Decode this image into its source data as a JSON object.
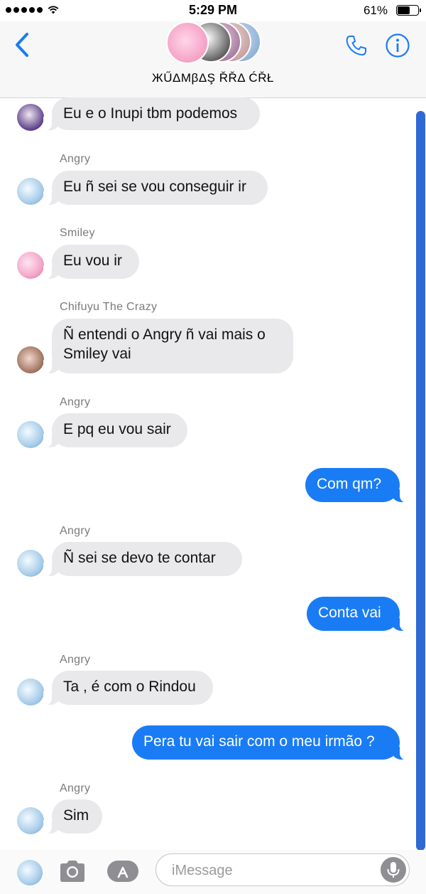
{
  "status_bar": {
    "time": "5:29 PM",
    "battery_percent": "61%",
    "battery_level": 0.61
  },
  "header": {
    "title": "ЖŰΔMβΔŞ ŘŘΔ ĆŘŁ",
    "back_icon": "chevron-left-icon",
    "call_icon": "phone-icon",
    "info_icon": "info-icon"
  },
  "messages": [
    {
      "sender": "",
      "text": "Eu e o Inupi tbm podemos",
      "outgoing": false,
      "avatar": "purple-hair-avatar"
    },
    {
      "sender": "Angry",
      "text": "Eu ñ sei se vou conseguir ir",
      "outgoing": false,
      "avatar": "blue-floral-avatar"
    },
    {
      "sender": "Smiley",
      "text": "Eu vou ir",
      "outgoing": false,
      "avatar": "pink-avatar"
    },
    {
      "sender": "Chifuyu The Crazy",
      "text_line1": "Ñ entendi o Angry ñ vai mais o",
      "text_line2": "Smiley vai",
      "outgoing": false,
      "avatar": "brown-avatar"
    },
    {
      "sender": "Angry",
      "text": "E pq eu vou sair",
      "outgoing": false,
      "avatar": "blue-floral-avatar"
    },
    {
      "sender": "",
      "text": "Com qm?",
      "outgoing": true
    },
    {
      "sender": "Angry",
      "text": "Ñ sei se devo te contar",
      "outgoing": false,
      "avatar": "blue-floral-avatar"
    },
    {
      "sender": "",
      "text": "Conta vai",
      "outgoing": true
    },
    {
      "sender": "Angry",
      "text": "Ta , é com o Rindou",
      "outgoing": false,
      "avatar": "blue-floral-avatar"
    },
    {
      "sender": "",
      "text": "Pera tu vai sair com o meu irmão ?",
      "outgoing": true
    },
    {
      "sender": "Angry",
      "text": "Sim",
      "outgoing": false,
      "avatar": "blue-floral-avatar"
    }
  ],
  "composer": {
    "placeholder": "iMessage",
    "camera_icon": "camera-icon",
    "apps_icon": "app-store-icon",
    "mic_icon": "microphone-icon"
  },
  "colors": {
    "accent": "#1a7cf5",
    "incoming_bubble": "#e9e9eb",
    "scrollbar": "#2f69d6"
  }
}
